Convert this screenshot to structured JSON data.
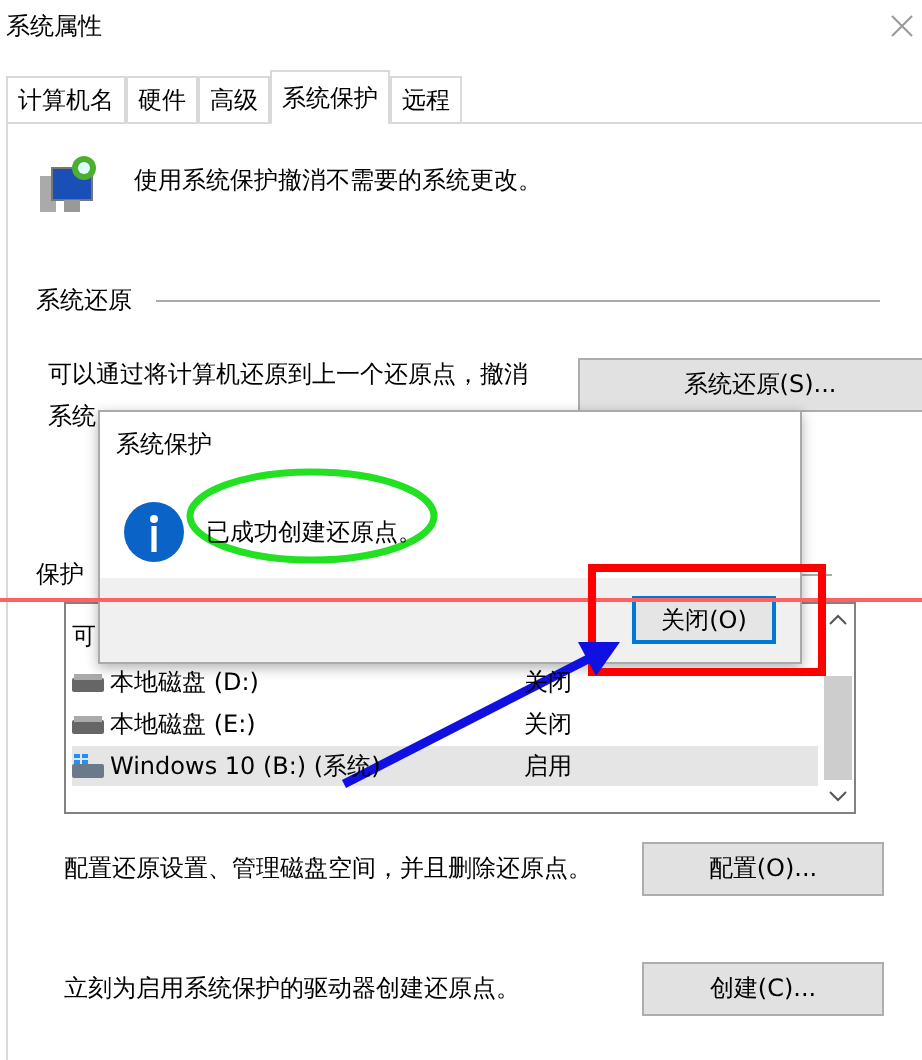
{
  "window": {
    "title": "系统属性"
  },
  "tabs": [
    {
      "label": "计算机名",
      "selected": false
    },
    {
      "label": "硬件",
      "selected": false
    },
    {
      "label": "高级",
      "selected": false
    },
    {
      "label": "系统保护",
      "selected": true
    },
    {
      "label": "远程",
      "selected": false
    }
  ],
  "intro": "使用系统保护撤消不需要的系统更改。",
  "restore": {
    "heading": "系统还原",
    "text_line_1": "可以通过将计算机还原到上一个还原点，撤消",
    "text_line_2": "系统",
    "button": "系统还原(S)..."
  },
  "protection": {
    "heading": "保护",
    "list": {
      "header": "可",
      "rows": [
        {
          "kind": "disk",
          "name": "本地磁盘 (D:)",
          "status": "关闭",
          "selected": false
        },
        {
          "kind": "disk",
          "name": "本地磁盘 (E:)",
          "status": "关闭",
          "selected": false
        },
        {
          "kind": "system",
          "name": "Windows 10 (B:) (系统)",
          "status": "启用",
          "selected": true
        }
      ]
    }
  },
  "configure": {
    "text": "配置还原设置、管理磁盘空间，并且删除还原点。",
    "button": "配置(O)..."
  },
  "create": {
    "text": "立刻为启用系统保护的驱动器创建还原点。",
    "button": "创建(C)..."
  },
  "message_box": {
    "title": "系统保护",
    "message": "已成功创建还原点。",
    "button": "关闭(O)"
  },
  "annotations": [
    {
      "kind": "line",
      "color": "#ff6060"
    },
    {
      "kind": "ellipse",
      "color": "#22e022"
    },
    {
      "kind": "rect",
      "color": "#ff0000"
    },
    {
      "kind": "arrow",
      "color": "#1010e0"
    }
  ]
}
